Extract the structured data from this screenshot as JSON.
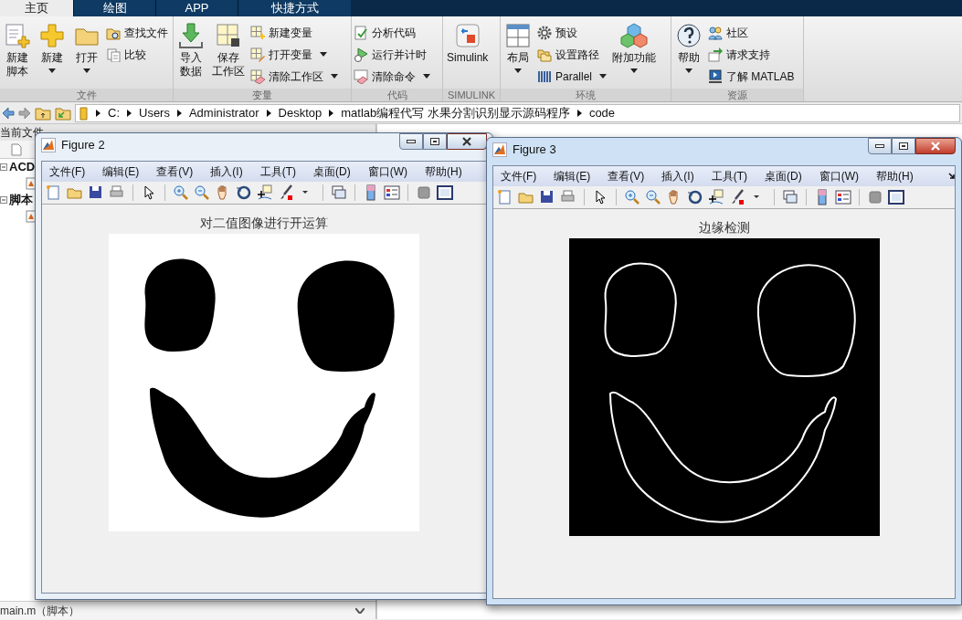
{
  "ribbon": {
    "tabs": [
      {
        "label": "主页",
        "selected": true
      },
      {
        "label": "绘图",
        "selected": false
      },
      {
        "label": "APP",
        "selected": false
      },
      {
        "label": "快捷方式",
        "selected": false
      }
    ],
    "groups": [
      {
        "title": "文件",
        "items": [
          {
            "kind": "large",
            "lines": [
              "新建",
              "脚本"
            ],
            "dropdown": false
          },
          {
            "kind": "large",
            "lines": [
              "新建"
            ],
            "dropdown": true
          },
          {
            "kind": "large",
            "lines": [
              "打开"
            ],
            "dropdown": true
          },
          {
            "kind": "small",
            "label": "查找文件",
            "dropdown": false
          },
          {
            "kind": "small",
            "label": "比较",
            "dropdown": false
          }
        ]
      },
      {
        "title": "变量",
        "items": [
          {
            "kind": "large",
            "lines": [
              "导入",
              "数据"
            ],
            "dropdown": false
          },
          {
            "kind": "large",
            "lines": [
              "保存",
              "工作区"
            ],
            "dropdown": false
          },
          {
            "kind": "small",
            "label": "新建变量",
            "dropdown": false
          },
          {
            "kind": "small",
            "label": "打开变量",
            "dropdown": true
          },
          {
            "kind": "small",
            "label": "清除工作区",
            "dropdown": true
          }
        ]
      },
      {
        "title": "代码",
        "items": [
          {
            "kind": "small",
            "label": "分析代码",
            "dropdown": false
          },
          {
            "kind": "small",
            "label": "运行并计时",
            "dropdown": false
          },
          {
            "kind": "small",
            "label": "清除命令",
            "dropdown": true
          }
        ]
      },
      {
        "title": "SIMULINK",
        "items": [
          {
            "kind": "large",
            "lines": [
              "Simulink"
            ],
            "dropdown": false
          }
        ]
      },
      {
        "title": "环境",
        "items": [
          {
            "kind": "large",
            "lines": [
              "布局"
            ],
            "dropdown": true
          },
          {
            "kind": "small",
            "label": "预设",
            "dropdown": false
          },
          {
            "kind": "small",
            "label": "设置路径",
            "dropdown": false
          },
          {
            "kind": "small",
            "label": "Parallel",
            "dropdown": true
          },
          {
            "kind": "large",
            "lines": [
              "附加功能"
            ],
            "dropdown": true
          }
        ]
      },
      {
        "title": "资源",
        "items": [
          {
            "kind": "large",
            "lines": [
              "帮助"
            ],
            "dropdown": true
          },
          {
            "kind": "small",
            "label": "社区",
            "dropdown": false
          },
          {
            "kind": "small",
            "label": "请求支持",
            "dropdown": false
          },
          {
            "kind": "small",
            "label": "了解 MATLAB",
            "dropdown": false
          }
        ]
      }
    ]
  },
  "address_bar": {
    "path": [
      "C:",
      "Users",
      "Administrator",
      "Desktop",
      "matlab编程代写 水果分割识别显示源码程序",
      "code"
    ]
  },
  "current_folder": {
    "title": "当前文件",
    "items": [
      {
        "label": "ACD"
      },
      {
        "label": "脚本"
      }
    ],
    "details": "main.m（脚本）"
  },
  "figures": [
    {
      "title": "Figure 2",
      "active": false,
      "menus": [
        "文件(F)",
        "编辑(E)",
        "查看(V)",
        "插入(I)",
        "工具(T)",
        "桌面(D)",
        "窗口(W)",
        "帮助(H)"
      ],
      "axes_title": "对二值图像进行开运算",
      "edge_image": false
    },
    {
      "title": "Figure 3",
      "active": true,
      "menus": [
        "文件(F)",
        "编辑(E)",
        "查看(V)",
        "插入(I)",
        "工具(T)",
        "桌面(D)",
        "窗口(W)",
        "帮助(H)"
      ],
      "axes_title": "边缘检测",
      "edge_image": true
    }
  ]
}
